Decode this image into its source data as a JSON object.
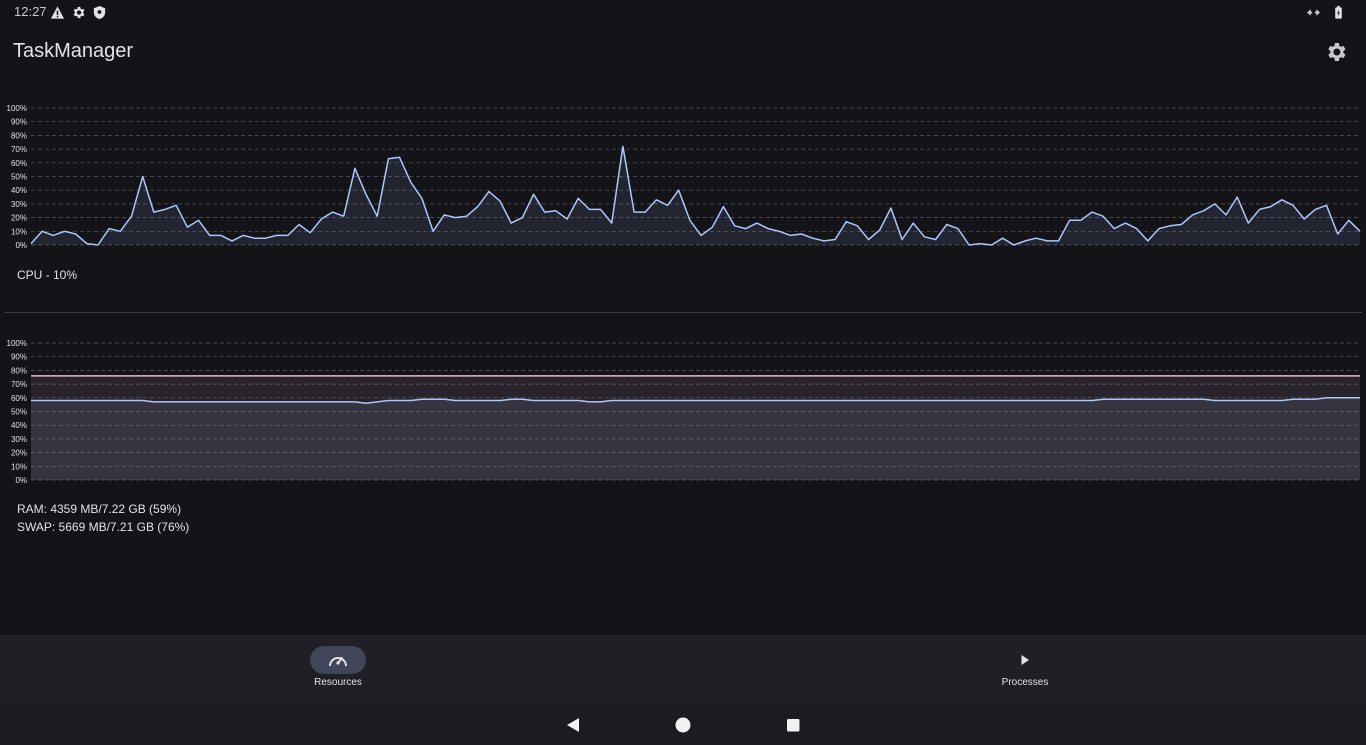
{
  "status_bar": {
    "time": "12:27",
    "left_icons": [
      "warning-icon",
      "gear-icon",
      "shield-icon"
    ],
    "right_icons": [
      "data-sync-icon",
      "battery-icon"
    ]
  },
  "app_bar": {
    "title": "TaskManager",
    "action_icon": "gear-icon"
  },
  "colors": {
    "background": "#131318",
    "cpu_line": "#aac7ff",
    "ram_line": "#aac7ff",
    "swap_line": "#e8b9d5",
    "grid": "#5a5a62",
    "nav_bar": "#1f1f25",
    "active_pill": "#40455a"
  },
  "cpu": {
    "caption": "CPU - 10%"
  },
  "memory": {
    "ram_caption": "RAM: 4359 MB/7.22 GB (59%)",
    "swap_caption": "SWAP: 5669 MB/7.21 GB (76%)"
  },
  "chart_data": [
    {
      "type": "area",
      "title": "",
      "xlabel": "",
      "ylabel": "",
      "ylim": [
        0,
        100
      ],
      "y_ticks": [
        "0%",
        "10%",
        "20%",
        "30%",
        "40%",
        "50%",
        "60%",
        "70%",
        "80%",
        "90%",
        "100%"
      ],
      "grid": true,
      "series": [
        {
          "values": [
            1,
            10,
            7,
            10,
            8,
            1,
            0,
            12,
            10,
            21,
            50,
            24,
            26,
            29,
            13,
            18,
            7,
            7,
            3,
            7,
            5,
            5,
            7,
            7,
            15,
            9,
            19,
            24,
            21,
            56,
            37,
            21,
            63,
            64,
            46,
            34,
            10,
            22,
            20,
            21,
            28,
            39,
            32,
            16,
            20,
            37,
            24,
            25,
            19,
            34,
            26,
            26,
            16,
            72,
            24,
            24,
            33,
            29,
            40,
            18,
            7,
            13,
            28,
            14,
            12,
            16,
            12,
            10,
            7,
            8,
            5,
            3,
            4,
            17,
            14,
            4,
            11,
            27,
            4,
            16,
            6,
            4,
            15,
            12,
            0,
            1,
            0,
            5,
            0,
            3,
            5,
            3,
            3,
            18,
            18,
            24,
            21,
            12,
            16,
            12,
            3,
            12,
            14,
            15,
            22,
            25,
            30,
            22,
            35,
            16,
            26,
            28,
            33,
            29,
            19,
            26,
            29,
            8,
            18,
            10
          ]
        }
      ]
    },
    {
      "type": "area",
      "title": "",
      "xlabel": "",
      "ylabel": "",
      "ylim": [
        0,
        100
      ],
      "y_ticks": [
        "0%",
        "10%",
        "20%",
        "30%",
        "40%",
        "50%",
        "60%",
        "70%",
        "80%",
        "90%",
        "100%"
      ],
      "grid": true,
      "series": [
        {
          "values": [
            58,
            58,
            58,
            58,
            58,
            58,
            58,
            58,
            58,
            58,
            58,
            57,
            57,
            57,
            57,
            57,
            57,
            57,
            57,
            57,
            57,
            57,
            57,
            57,
            57,
            57,
            57,
            57,
            57,
            57,
            56,
            57,
            58,
            58,
            58,
            59,
            59,
            59,
            58,
            58,
            58,
            58,
            58,
            59,
            59,
            58,
            58,
            58,
            58,
            58,
            57,
            57,
            58,
            58,
            58,
            58,
            58,
            58,
            58,
            58,
            58,
            58,
            58,
            58,
            58,
            58,
            58,
            58,
            58,
            58,
            58,
            58,
            58,
            58,
            58,
            58,
            58,
            58,
            58,
            58,
            58,
            58,
            58,
            58,
            58,
            58,
            58,
            58,
            58,
            58,
            58,
            58,
            58,
            58,
            58,
            58,
            59,
            59,
            59,
            59,
            59,
            59,
            59,
            59,
            59,
            59,
            58,
            58,
            58,
            58,
            58,
            58,
            58,
            59,
            59,
            59,
            60,
            60,
            60,
            60
          ]
        },
        {
          "values": [
            76,
            76
          ]
        }
      ]
    }
  ],
  "bottom_nav": {
    "items": [
      {
        "label": "Resources",
        "icon": "speedometer-icon",
        "active": true
      },
      {
        "label": "Processes",
        "icon": "play-icon",
        "active": false
      }
    ]
  },
  "system_nav": {
    "buttons": [
      "back-icon",
      "home-icon",
      "recents-icon"
    ]
  }
}
